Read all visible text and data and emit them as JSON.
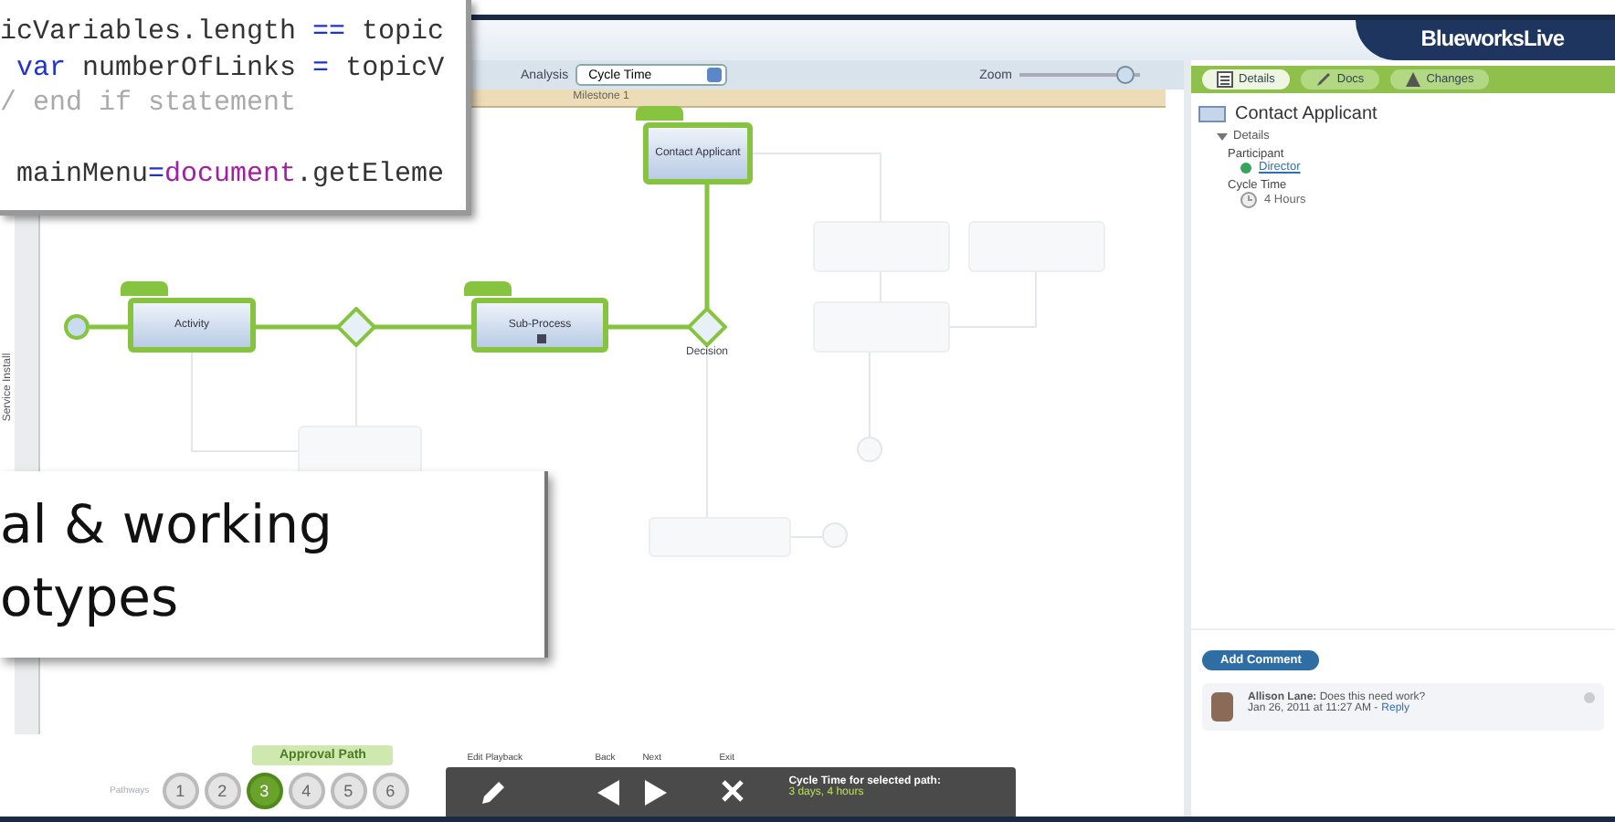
{
  "code_snippet": {
    "lines": [
      [
        {
          "text": "icVariables.length ",
          "kind": "plain"
        },
        {
          "text": "==",
          "kind": "keyword"
        },
        {
          "text": " topic",
          "kind": "plain"
        }
      ],
      [
        {
          "text": " var",
          "kind": "keyword"
        },
        {
          "text": " numberOfLinks ",
          "kind": "plain"
        },
        {
          "text": "=",
          "kind": "keyword"
        },
        {
          "text": " topicV",
          "kind": "plain"
        }
      ],
      [
        {
          "text": "/ end if statement",
          "kind": "comment"
        }
      ],
      [
        {
          "text": " mainMenu",
          "kind": "plain"
        },
        {
          "text": "=",
          "kind": "keyword"
        },
        {
          "text": "document",
          "kind": "object"
        },
        {
          "text": ".getEleme",
          "kind": "plain"
        }
      ]
    ]
  },
  "slide_caption": {
    "lines": [
      "al & working",
      "otypes"
    ]
  },
  "header": {
    "logo": "BlueworksLive"
  },
  "toolbar": {
    "analysis_label": "Analysis",
    "analysis_value": "Cycle Time",
    "zoom_label": "Zoom",
    "zoom": {
      "level": 0.95
    }
  },
  "milestone": "Milestone 1",
  "lane": "Service Install",
  "diagram": {
    "nodes": [
      {
        "kind": "start",
        "highlighted": true
      },
      {
        "kind": "task",
        "label": "Activity",
        "highlighted": true
      },
      {
        "kind": "gateway",
        "highlighted": true
      },
      {
        "kind": "subprocess",
        "label": "Sub-Process",
        "highlighted": true
      },
      {
        "kind": "gateway",
        "label": "Decision",
        "highlighted": true
      },
      {
        "kind": "task",
        "label": "Contact Applicant",
        "highlighted": true
      },
      {
        "kind": "task",
        "highlighted": false
      },
      {
        "kind": "task",
        "highlighted": false
      },
      {
        "kind": "task",
        "highlighted": false
      },
      {
        "kind": "end",
        "highlighted": false
      },
      {
        "kind": "task",
        "highlighted": false
      },
      {
        "kind": "task",
        "highlighted": false
      },
      {
        "kind": "end",
        "highlighted": false
      }
    ]
  },
  "pathways": {
    "label": "Pathways",
    "path_name": "Approval Path",
    "paths": [
      {
        "label": "1",
        "selected": false
      },
      {
        "label": "2",
        "selected": false
      },
      {
        "label": "3",
        "selected": true
      },
      {
        "label": "4",
        "selected": false
      },
      {
        "label": "5",
        "selected": false
      },
      {
        "label": "6",
        "selected": false
      }
    ]
  },
  "playback": {
    "buttons": [
      {
        "kind": "edit",
        "label": "Edit Playback"
      },
      {
        "kind": "back",
        "label": "Back"
      },
      {
        "kind": "next",
        "label": "Next"
      },
      {
        "kind": "exit",
        "label": "Exit"
      }
    ],
    "summary_title": "Cycle Time for selected path:",
    "summary_value": "3 days, 4 hours"
  },
  "panel": {
    "tabs": [
      {
        "kind": "details",
        "label": "Details",
        "selected": true
      },
      {
        "kind": "docs",
        "label": "Docs",
        "selected": false
      },
      {
        "kind": "changes",
        "label": "Changes",
        "selected": false
      }
    ],
    "title": "Contact Applicant",
    "section": {
      "label": "Details",
      "expanded": true
    },
    "fields": [
      {
        "kind": "participant",
        "label": "Participant",
        "value": "Director"
      },
      {
        "kind": "time",
        "label": "Cycle Time",
        "value": "4 Hours"
      }
    ],
    "add_comment": "Add Comment",
    "comment": {
      "author": "Allison Lane:",
      "text": "Does this need work?",
      "date": "Jan 26, 2011 at 11:27 AM -",
      "reply": "Reply"
    }
  }
}
